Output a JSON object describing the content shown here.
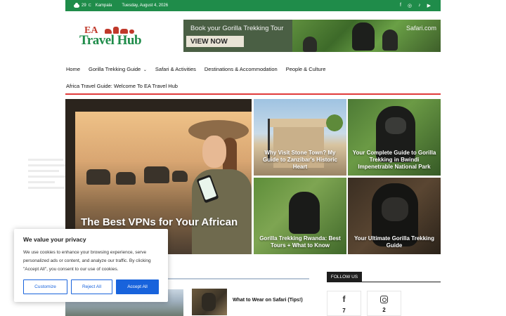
{
  "topbar": {
    "temperature": "29",
    "temp_unit": "C",
    "city": "Kampala",
    "date": "Tuesday, August 4, 2026",
    "socials": [
      "facebook-icon",
      "instagram-icon",
      "tiktok-icon",
      "youtube-icon"
    ],
    "color": "#1f8c4a"
  },
  "logo": {
    "top_text": "EA",
    "main_text": "Travel Hub"
  },
  "banner": {
    "headline": "Book your Gorilla Trekking Tour",
    "cta": "VIEW NOW",
    "brand": "Safari.com"
  },
  "nav": {
    "items": [
      {
        "label": "Home"
      },
      {
        "label": "Gorilla Trekking Guide"
      },
      {
        "label": "Safari & Activities"
      },
      {
        "label": "Destinations & Accommodation"
      },
      {
        "label": "People & Culture"
      }
    ],
    "second_row": "Africa Travel Guide: Welcome To EA Travel Hub",
    "accent": "#e03a3a"
  },
  "featured": {
    "hero_title": "The Best VPNs for Your African Safari",
    "tiles": [
      {
        "title": "Why Visit Stone Town? My Guide to Zanzibar's Historic Heart"
      },
      {
        "title": "Your Complete Guide to Gorilla Trekking in Bwindi Impenetrable National Park"
      },
      {
        "title": "Gorilla Trekking Rwanda: Best Tours + What to Know"
      },
      {
        "title": "Your Ultimate Gorilla Trekking Guide"
      }
    ]
  },
  "posts": {
    "side_post_title": "What to Wear on Safari (Tips!)"
  },
  "follow": {
    "heading": "FOLLOW US",
    "facebook_count": "7",
    "instagram_count": "2"
  },
  "cookie": {
    "title": "We value your privacy",
    "body": "We use cookies to enhance your browsing experience, serve personalized ads or content, and analyze our traffic. By clicking \"Accept All\", you consent to our use of cookies.",
    "customize": "Customize",
    "reject": "Reject All",
    "accept": "Accept All",
    "accent": "#1863dc"
  }
}
